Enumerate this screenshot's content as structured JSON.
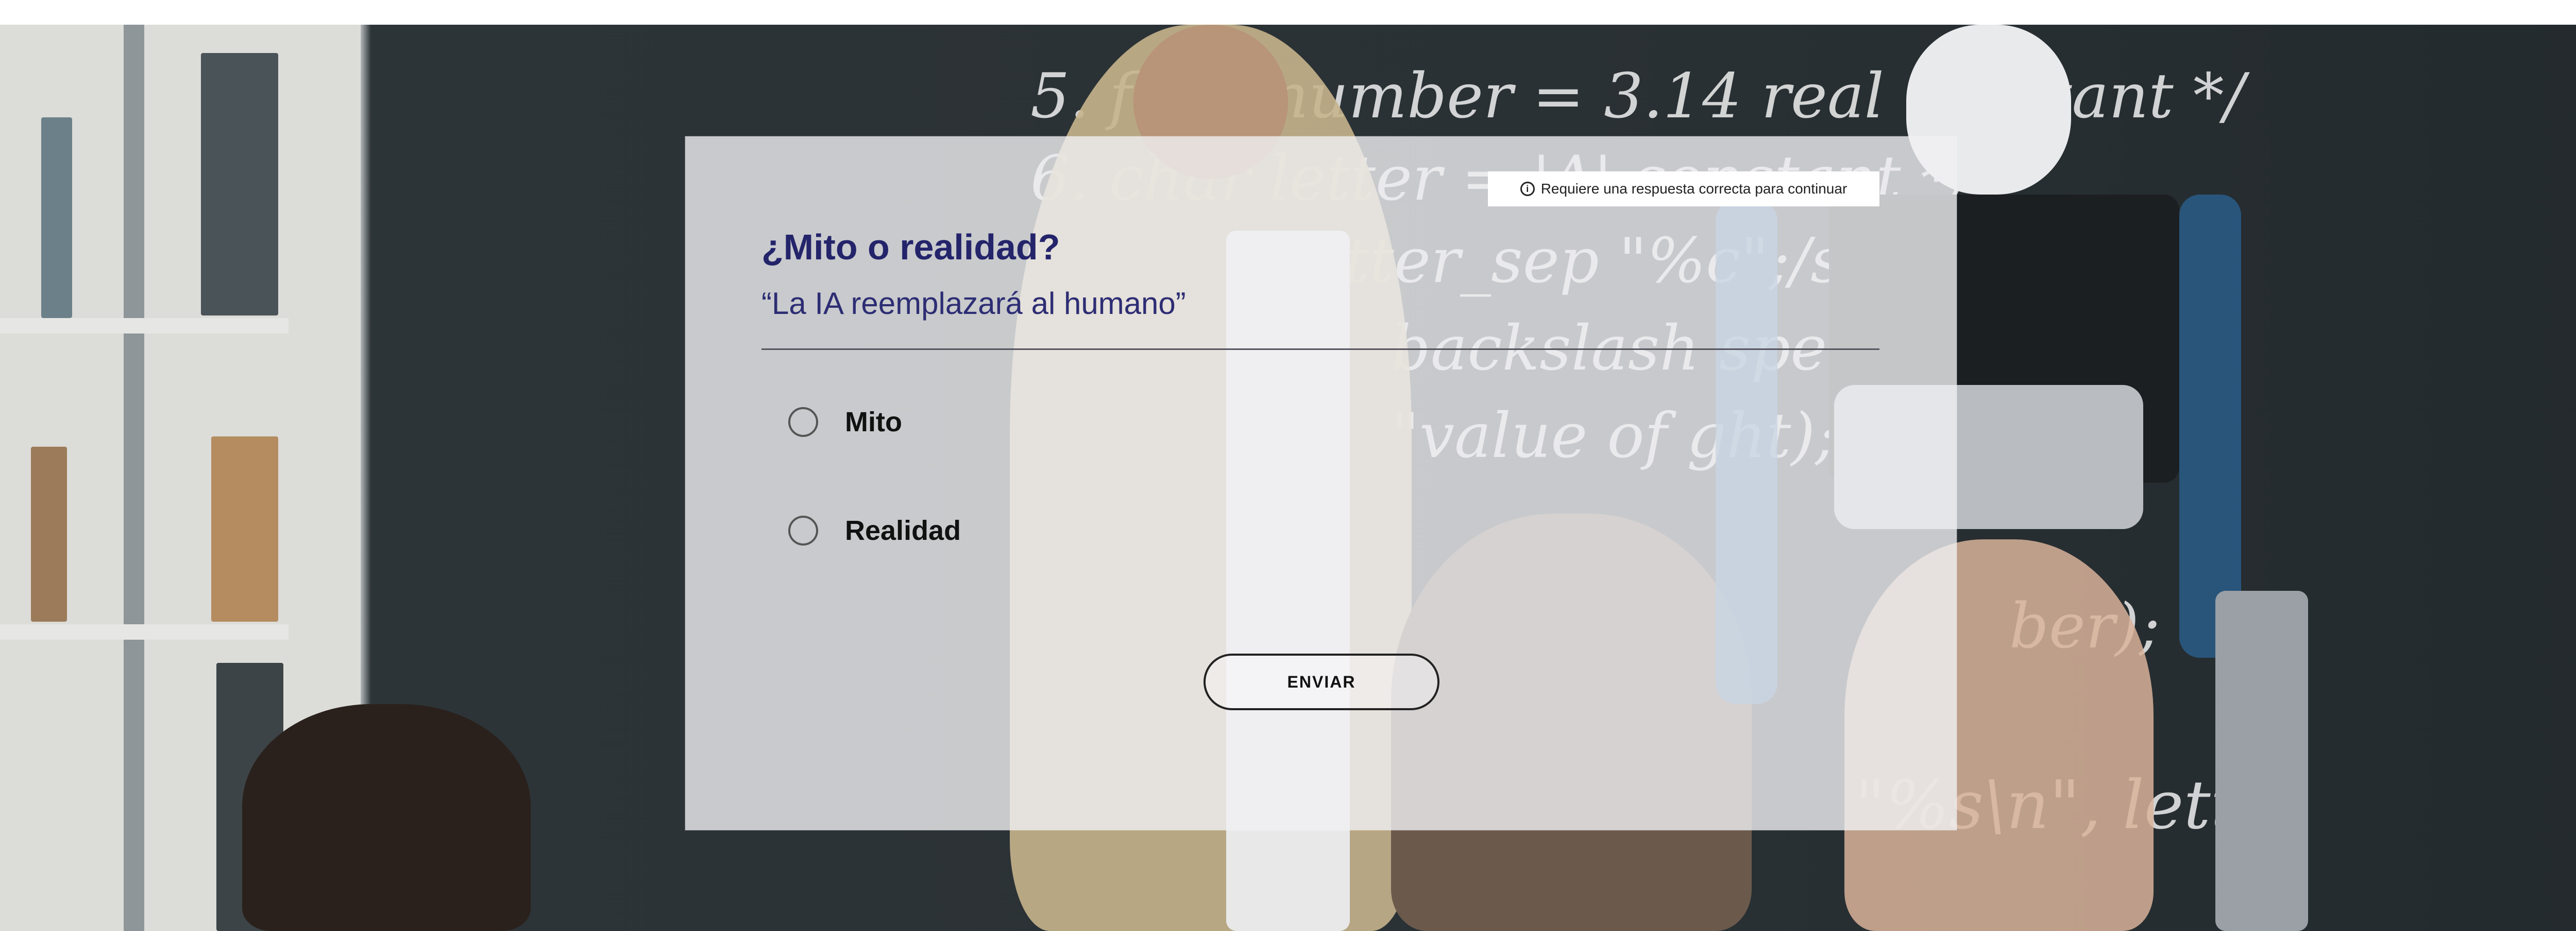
{
  "notice": {
    "icon": "info-icon",
    "text": "Requiere una respuesta correcta para continuar"
  },
  "question": {
    "title": "¿Mito o realidad?",
    "statement": "“La IA reemplazará al humano”"
  },
  "options": [
    {
      "label": "Mito",
      "selected": false
    },
    {
      "label": "Realidad",
      "selected": false
    }
  ],
  "submit_label": "ENVIAR",
  "colors": {
    "title": "#24246b",
    "card_overlay": "rgba(240,240,243,0.80)"
  }
}
